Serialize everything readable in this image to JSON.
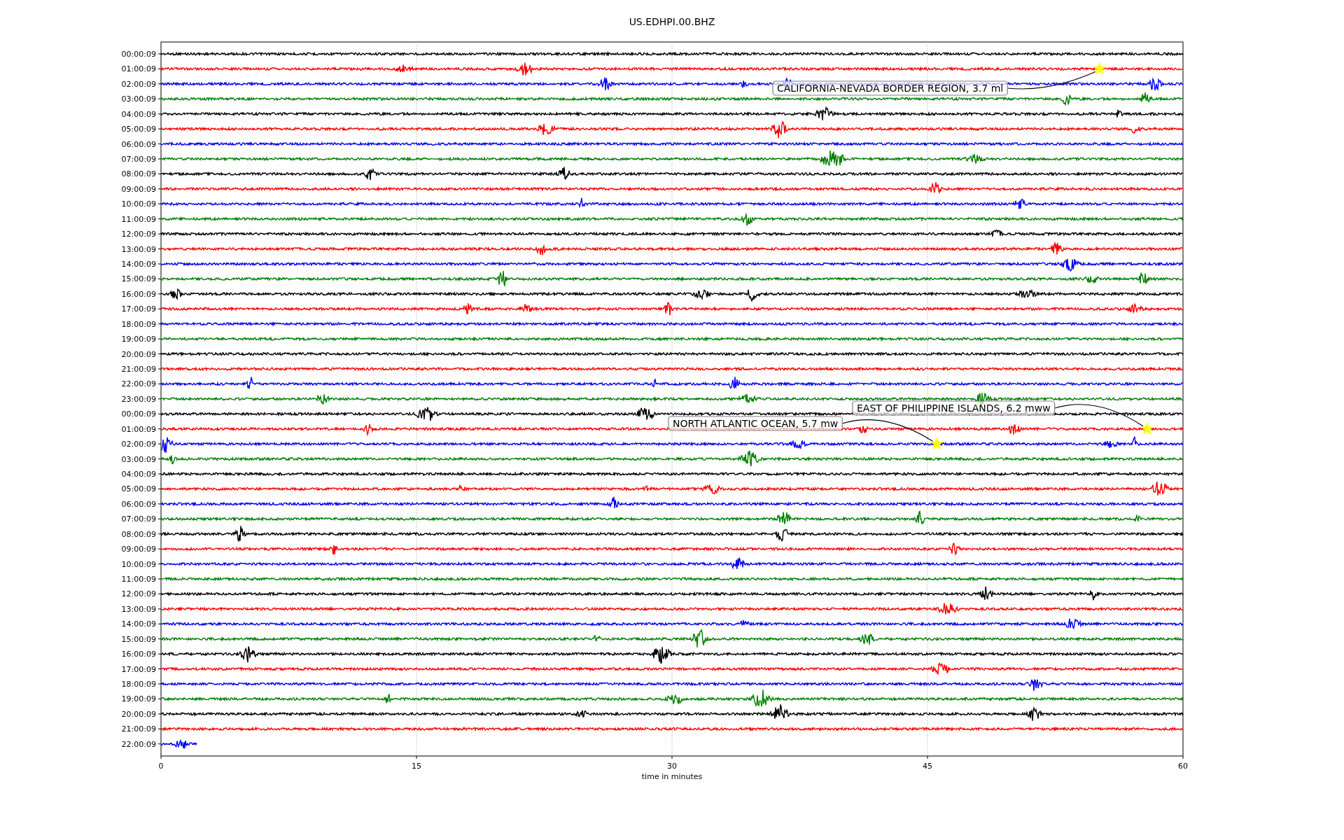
{
  "title": "US.EDHPI.00.BHZ",
  "rows": [
    {
      "time": "00:00:09",
      "color": "#000000"
    },
    {
      "time": "01:00:09",
      "color": "#ff0000",
      "events": [
        {
          "label": "CALIFORNIA-NEVADA BORDER REGION, 3.7 ml"
        }
      ]
    },
    {
      "time": "02:00:09",
      "color": "#0000ff"
    },
    {
      "time": "03:00:09",
      "color": "#008000"
    },
    {
      "time": "04:00:09",
      "color": "#000000"
    },
    {
      "time": "05:00:09",
      "color": "#ff0000"
    },
    {
      "time": "06:00:09",
      "color": "#0000ff"
    },
    {
      "time": "07:00:09",
      "color": "#008000"
    },
    {
      "time": "08:00:09",
      "color": "#000000"
    },
    {
      "time": "09:00:09",
      "color": "#ff0000"
    },
    {
      "time": "10:00:09",
      "color": "#0000ff"
    },
    {
      "time": "11:00:09",
      "color": "#008000"
    },
    {
      "time": "12:00:09",
      "color": "#000000"
    },
    {
      "time": "13:00:09",
      "color": "#ff0000"
    },
    {
      "time": "14:00:09",
      "color": "#0000ff"
    },
    {
      "time": "15:00:09",
      "color": "#008000"
    },
    {
      "time": "16:00:09",
      "color": "#000000"
    },
    {
      "time": "17:00:09",
      "color": "#ff0000"
    },
    {
      "time": "18:00:09",
      "color": "#0000ff"
    },
    {
      "time": "19:00:09",
      "color": "#008000"
    },
    {
      "time": "20:00:09",
      "color": "#000000"
    },
    {
      "time": "21:00:09",
      "color": "#ff0000"
    },
    {
      "time": "22:00:09",
      "color": "#0000ff"
    },
    {
      "time": "23:00:09",
      "color": "#008000"
    },
    {
      "time": "00:00:09",
      "color": "#000000"
    },
    {
      "time": "01:00:09",
      "color": "#ff0000",
      "events": [
        {
          "label": "EAST OF PHILIPPINE ISLANDS, 6.2 mww"
        }
      ]
    },
    {
      "time": "02:00:09",
      "color": "#0000ff",
      "events": [
        {
          "label": "NORTH ATLANTIC OCEAN, 5.7 mw"
        }
      ]
    },
    {
      "time": "03:00:09",
      "color": "#008000"
    },
    {
      "time": "04:00:09",
      "color": "#000000"
    },
    {
      "time": "05:00:09",
      "color": "#ff0000"
    },
    {
      "time": "06:00:09",
      "color": "#0000ff"
    },
    {
      "time": "07:00:09",
      "color": "#008000"
    },
    {
      "time": "08:00:09",
      "color": "#000000"
    },
    {
      "time": "09:00:09",
      "color": "#ff0000"
    },
    {
      "time": "10:00:09",
      "color": "#0000ff"
    },
    {
      "time": "11:00:09",
      "color": "#008000"
    },
    {
      "time": "12:00:09",
      "color": "#000000"
    },
    {
      "time": "13:00:09",
      "color": "#ff0000"
    },
    {
      "time": "14:00:09",
      "color": "#0000ff"
    },
    {
      "time": "15:00:09",
      "color": "#008000"
    },
    {
      "time": "16:00:09",
      "color": "#000000"
    },
    {
      "time": "17:00:09",
      "color": "#ff0000"
    },
    {
      "time": "18:00:09",
      "color": "#0000ff"
    },
    {
      "time": "19:00:09",
      "color": "#008000"
    },
    {
      "time": "20:00:09",
      "color": "#000000"
    },
    {
      "time": "21:00:09",
      "color": "#ff0000"
    },
    {
      "time": "22:00:09",
      "color": "#0000ff",
      "partial": true
    }
  ],
  "x_ticks": [
    "0",
    "15",
    "30",
    "45",
    "60"
  ],
  "xlabel": "time in minutes"
}
